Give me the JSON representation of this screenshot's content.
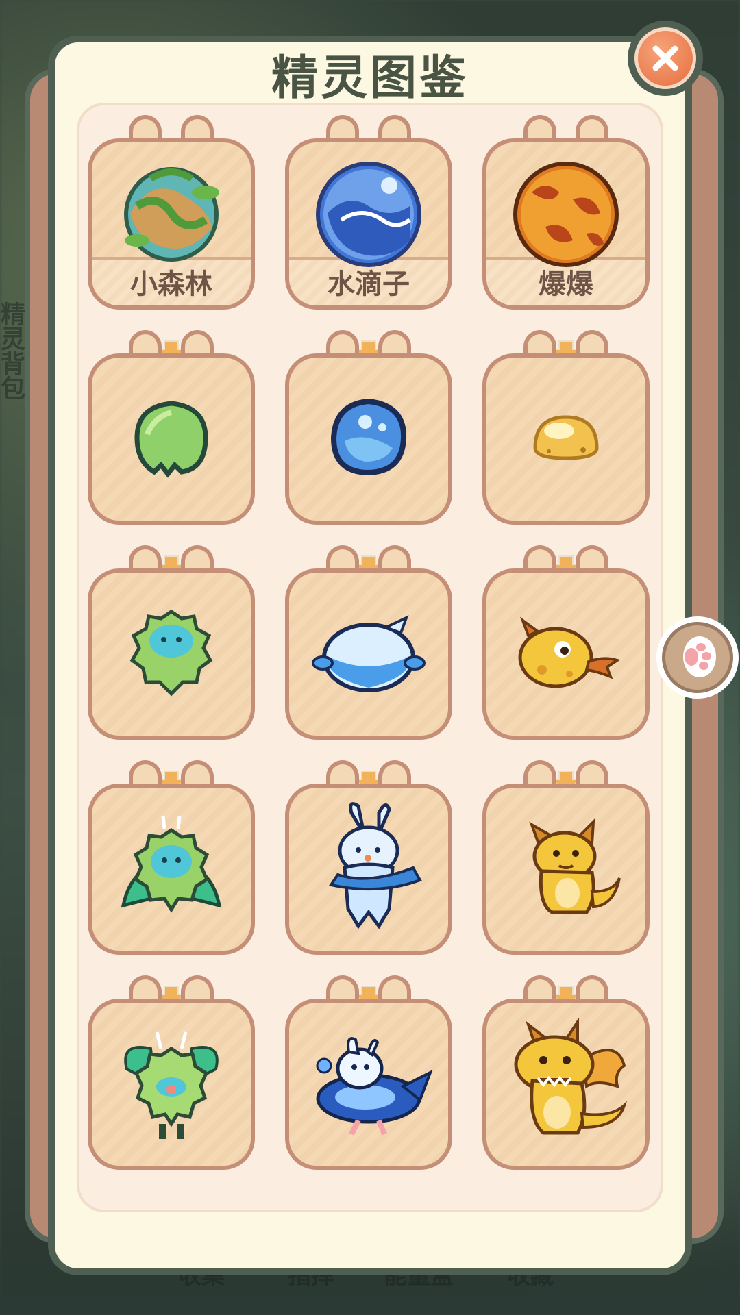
{
  "modal": {
    "title": "精灵图鉴",
    "close_icon": "close-icon"
  },
  "background": {
    "side_text": "精灵背包",
    "bottom_labels": [
      "收集",
      "指挥",
      "能量盒",
      "收藏"
    ]
  },
  "columns": [
    {
      "name": "小森林",
      "element_color": "#7fbf5a",
      "stages": [
        "forest-orb-icon",
        "leaf-seed-icon",
        "fluffy-sprout-icon",
        "leaf-fluff-icon",
        "forest-fairy-icon"
      ]
    },
    {
      "name": "水滴子",
      "element_color": "#4f86e0",
      "stages": [
        "water-orb-icon",
        "water-bubble-icon",
        "water-blob-icon",
        "water-bunny-icon",
        "ocean-rider-icon"
      ]
    },
    {
      "name": "爆爆",
      "element_color": "#e2862f",
      "stages": [
        "fire-orb-icon",
        "golden-egg-icon",
        "fire-tadpole-icon",
        "baby-dragon-icon",
        "winged-dragon-icon"
      ]
    }
  ],
  "side_button": {
    "icon": "paw-icon"
  }
}
